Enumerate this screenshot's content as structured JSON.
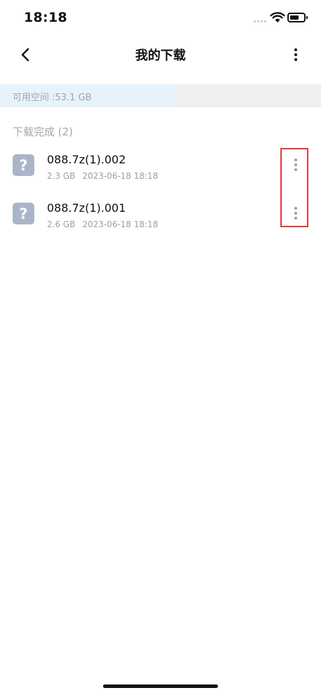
{
  "status_bar": {
    "time": "18:18"
  },
  "nav": {
    "title": "我的下载"
  },
  "storage": {
    "label": "可用空间 :53.1 GB",
    "used_fraction": 0.55,
    "fill_color": "#e7f3fc"
  },
  "section": {
    "title": "下载完成 (2)"
  },
  "files": [
    {
      "name": "088.7z(1).002",
      "size": "2.3 GB",
      "date": "2023-06-18 18:18",
      "icon": "unknown-file-icon"
    },
    {
      "name": "088.7z(1).001",
      "size": "2.6 GB",
      "date": "2023-06-18 18:18",
      "icon": "unknown-file-icon"
    }
  ],
  "highlight_color": "#e53935"
}
